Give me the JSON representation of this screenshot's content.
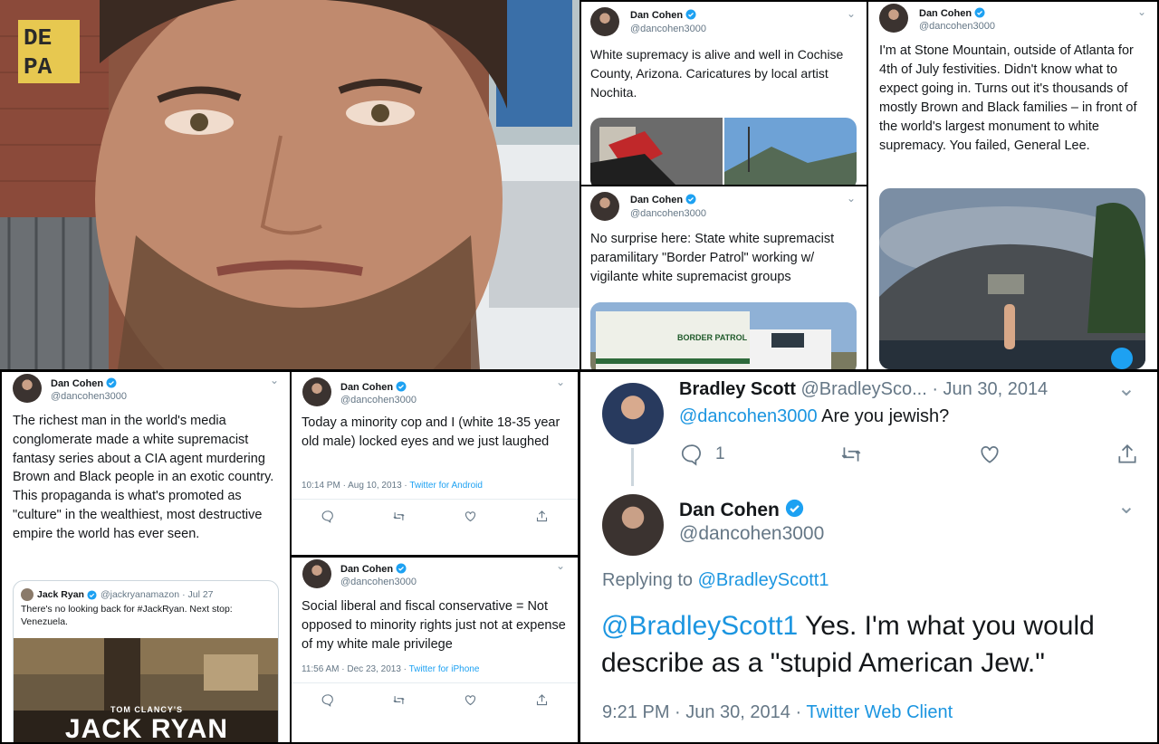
{
  "colors": {
    "accent": "#1da1f2",
    "verified": "#1da1f2",
    "text": "#14171a",
    "muted": "#657786"
  },
  "photo": {
    "sign_letters": [
      "DE",
      "PA"
    ]
  },
  "t1": {
    "name": "Dan Cohen",
    "handle": "@dancohen3000",
    "text": "White supremacy is alive and well in Cochise County, Arizona. Caricatures by local artist Nochita."
  },
  "t2": {
    "name": "Dan Cohen",
    "handle": "@dancohen3000",
    "text": "I'm at Stone Mountain, outside of Atlanta for 4th of July festivities. Didn't know what to expect going in. Turns out it's thousands of mostly Brown and Black families – in front of the world's largest monument to white supremacy. You failed, General Lee."
  },
  "t3": {
    "name": "Dan Cohen",
    "handle": "@dancohen3000",
    "text": "No surprise here: State white supremacist paramilitary \"Border Patrol\" working w/ vigilante white supremacist groups",
    "vehicle_text": "BORDER PATROL"
  },
  "t4": {
    "name": "Dan Cohen",
    "handle": "@dancohen3000",
    "text": "The richest man in the world's media conglomerate made a white supremacist fantasy series about a CIA agent murdering Brown and Black people in an exotic country. This propaganda is what's promoted as \"culture\" in the wealthiest, most destructive empire the world has ever seen.",
    "quote": {
      "name": "Jack Ryan",
      "handle": "@jackryanamazon",
      "date": "· Jul 27",
      "text": "There's no looking back for #JackRyan. Next stop: Venezuela.",
      "poster_small": "TOM CLANCY'S",
      "poster_big": "JACK RYAN"
    }
  },
  "t5": {
    "name": "Dan Cohen",
    "handle": "@dancohen3000",
    "text": "Today a minority cop and I (white 18-35 year old male) locked eyes and we just laughed",
    "time": "10:14 PM · Aug 10, 2013 · ",
    "source": "Twitter for Android"
  },
  "t6": {
    "name": "Dan Cohen",
    "handle": "@dancohen3000",
    "text": "Social liberal and fiscal conservative = Not opposed to minority rights just not at expense of my white male privilege",
    "time": "11:56 AM · Dec 23, 2013 · ",
    "source": "Twitter for iPhone"
  },
  "thread": {
    "reply_name": "Bradley Scott",
    "reply_handle": "@BradleySco...",
    "reply_date": "· Jun 30, 2014",
    "reply_mention": "@dancohen3000",
    "reply_text": " Are you jewish?",
    "reply_count": "1",
    "main_name": "Dan Cohen",
    "main_handle": "@dancohen3000",
    "replying_to_label": "Replying to ",
    "replying_to_handle": "@BradleyScott1",
    "main_mention": "@BradleyScott1",
    "main_text": " Yes. I'm what you would describe as a \"stupid American Jew.\"",
    "time": "9:21 PM · Jun 30, 2014 · ",
    "source": "Twitter Web Client"
  }
}
